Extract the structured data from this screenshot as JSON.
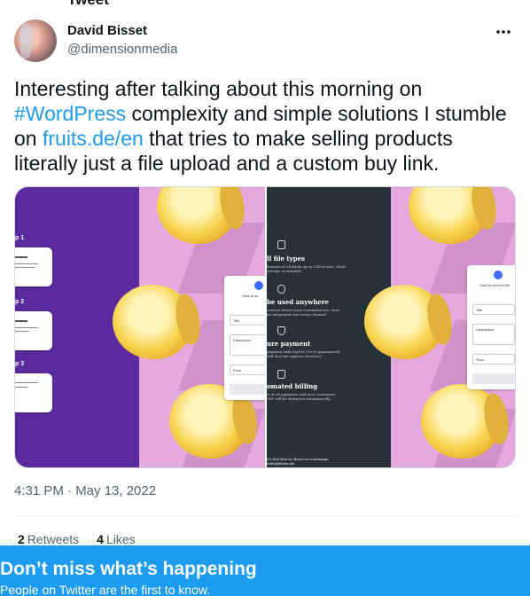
{
  "top_cut_text": "Tweet",
  "author": {
    "name": "David Bisset",
    "handle": "@dimensionmedia"
  },
  "tweet": {
    "text_part1": "Interesting after talking about this morning on ",
    "hashtag": "#WordPress",
    "text_part2": " complexity and simple solutions I stumble on ",
    "link": "fruits.de/en",
    "text_part3": " that tries to make selling products literally just a file upload and a custom buy link."
  },
  "media": {
    "left": {
      "steps": [
        "p 1",
        "p 2",
        "p 3"
      ],
      "form_title": "Click to se",
      "fields": [
        "Title",
        "Description",
        "Price"
      ]
    },
    "right": {
      "features": [
        {
          "title": "ll file types",
          "sub": "formats of all kinds up to 2GB in size, cloud\nstorage is included."
        },
        {
          "title": "be used anywhere",
          "sub": "content where your customers are. Your\nbe integrated into every channel!"
        },
        {
          "title": "ure payment",
          "sub": "payment with PayPal (100% guaranteed).\nwill love the express checkout."
        },
        {
          "title": "omated billing",
          "sub": "w of all payments and your customers.\nVAT will be deducted automatically."
        }
      ],
      "footer": "n't feel free to shoot us a message\nhello@fruits.de",
      "form_title": "Click to select a file",
      "fields": [
        "Title",
        "Description",
        "Price"
      ]
    }
  },
  "timestamp": "4:31 PM · May 13, 2022",
  "stats": {
    "retweets_count": "2",
    "retweets_label": "Retweets",
    "likes_count": "4",
    "likes_label": "Likes"
  },
  "banner": {
    "title": "Don’t miss what’s happening",
    "subtitle": "People on Twitter are the first to know."
  },
  "colors": {
    "link": "#1d9bf0",
    "banner": "#1d9bf0",
    "secondary_text": "#536471"
  },
  "icons": {
    "more": "more-horizontal-icon"
  }
}
